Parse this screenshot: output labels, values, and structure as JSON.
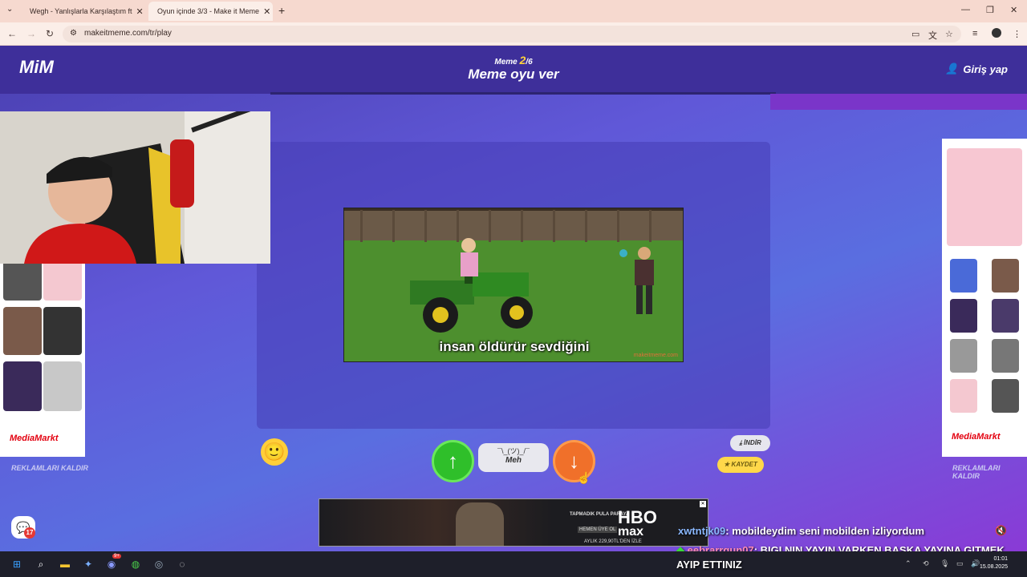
{
  "browser": {
    "tabs": [
      {
        "title": "Wegh - Yanlışlarla Karşılaştım ft",
        "active": false
      },
      {
        "title": "Oyun içinde 3/3 - Make it Meme",
        "active": true
      }
    ],
    "url": "makeitmeme.com/tr/play"
  },
  "header": {
    "logo": "MiM",
    "round_label": "Meme",
    "round_current": "2",
    "round_total": "/6",
    "subtitle": "Meme oyu ver",
    "login_label": "Giriş yap"
  },
  "meme": {
    "caption": "insan öldürür sevdiğini",
    "watermark": "makeitmeme.com"
  },
  "vote": {
    "meh_face": "¯\\_(ツ)_/¯",
    "meh_label": "Meh"
  },
  "actions": {
    "download_label": "İNDİR",
    "save_label": "KAYDET",
    "remove_ads_label": "REKLAMLARI KALDIR",
    "chat_badge": "17"
  },
  "ads": {
    "side_brand": "MediaMarkt",
    "bottom": {
      "brand": "HBO",
      "brand2": "max",
      "line1": "TAPMADIK PULA PARAYA",
      "cta": "HEMEN ÜYE OL",
      "price": "AYLIK 229,90TL'DEN İZLE"
    }
  },
  "stream_chat": [
    {
      "user": "xwtntjk09",
      "message": ": mobildeydim seni mobilden izliyordum"
    },
    {
      "user": "eebrarrgun07",
      "message": ": BIGI NIN YAYIN VARKEN BASKA YAYINA GITMEK"
    },
    {
      "user": "",
      "message": "AYIP ETTINIZ"
    }
  ],
  "taskbar": {
    "time": "01:01",
    "date": "15.08.2025",
    "discord_badge": "9+"
  },
  "colors": {
    "header_bg": "#3e2f9a",
    "upvote": "#2fbf2a",
    "downvote": "#f0702a",
    "accent_yellow": "#ffd23b"
  }
}
